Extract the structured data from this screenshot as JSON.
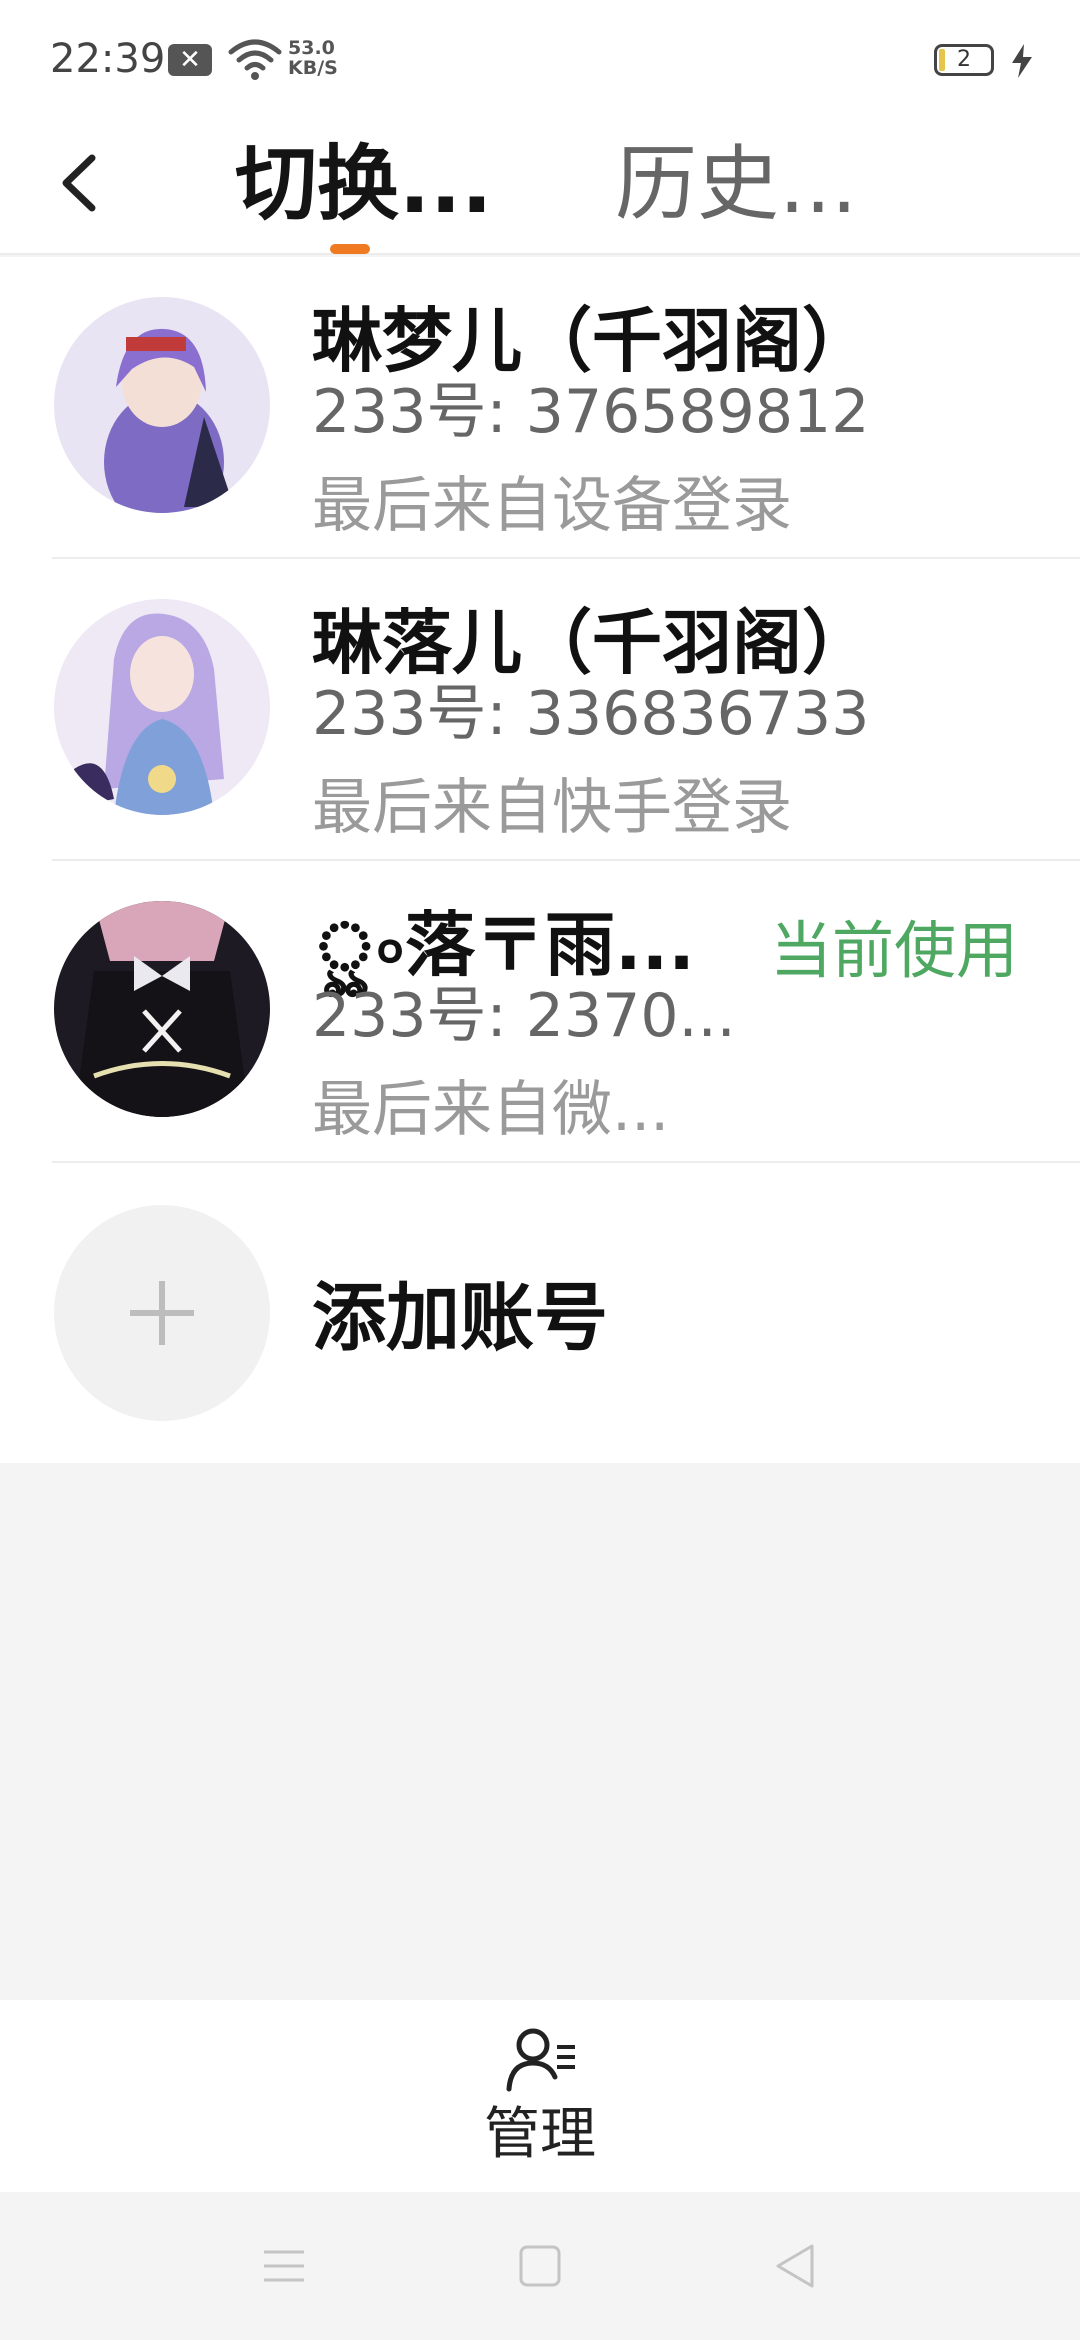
{
  "status_bar": {
    "time": "22:39",
    "notification_icon": "close-box-icon",
    "net_speed_value": "53.0",
    "net_speed_unit": "KB/S",
    "battery_level": "2"
  },
  "header": {
    "tab_switch": "切换...",
    "tab_history": "历史...",
    "accent_color": "#f07a22"
  },
  "accounts": [
    {
      "name": "琳梦儿（千羽阁）",
      "uid": "233号: 376589812",
      "last_login": "最后来自设备登录",
      "current": false,
      "avatar_colors": [
        "#c9b8ea",
        "#7d6bc4"
      ]
    },
    {
      "name": "琳落儿（千羽阁）",
      "uid": "233号: 336836733",
      "last_login": "最后来自快手登录",
      "current": false,
      "avatar_colors": [
        "#e2d6f3",
        "#7fa0d8"
      ]
    },
    {
      "name": "ৣ৹落〒雨...",
      "uid": "233号: 2370...",
      "last_login": "最后来自微...",
      "current": true,
      "current_label": "当前使用",
      "avatar_colors": [
        "#3a3346",
        "#111111"
      ]
    }
  ],
  "add_account": {
    "label": "添加账号"
  },
  "bottom_bar": {
    "manage_label": "管理",
    "manage_icon": "user-manage-icon"
  },
  "nav_bar": {
    "icons": [
      "menu-icon",
      "home-square-icon",
      "back-triangle-icon"
    ]
  },
  "colors": {
    "current_tag": "#4fa862"
  }
}
